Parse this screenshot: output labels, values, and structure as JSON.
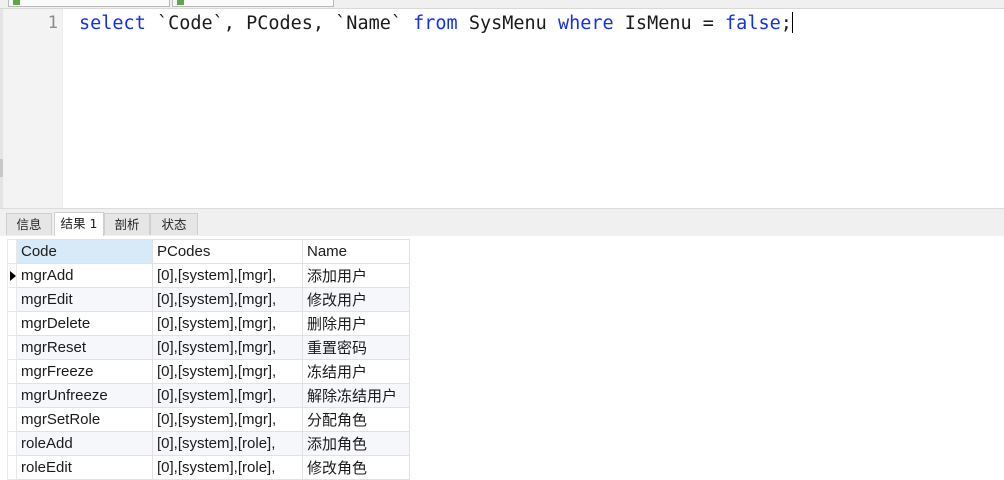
{
  "editor": {
    "line_number": "1",
    "tokens": {
      "select": "select",
      "code_col": " `Code`, PCodes, `Name` ",
      "from": "from",
      "table": " SysMenu ",
      "where": "where",
      "cond": " IsMenu = ",
      "false": "false",
      "semi": ";"
    }
  },
  "tabs": [
    "信息",
    "结果 1",
    "剖析",
    "状态"
  ],
  "active_tab": 1,
  "grid": {
    "columns": [
      "Code",
      "PCodes",
      "Name"
    ],
    "rows": [
      [
        "mgrAdd",
        "[0],[system],[mgr],",
        "添加用户"
      ],
      [
        "mgrEdit",
        "[0],[system],[mgr],",
        "修改用户"
      ],
      [
        "mgrDelete",
        "[0],[system],[mgr],",
        "删除用户"
      ],
      [
        "mgrReset",
        "[0],[system],[mgr],",
        "重置密码"
      ],
      [
        "mgrFreeze",
        "[0],[system],[mgr],",
        "冻结用户"
      ],
      [
        "mgrUnfreeze",
        "[0],[system],[mgr],",
        "解除冻结用户"
      ],
      [
        "mgrSetRole",
        "[0],[system],[mgr],",
        "分配角色"
      ],
      [
        "roleAdd",
        "[0],[system],[role],",
        "添加角色"
      ],
      [
        "roleEdit",
        "[0],[system],[role],",
        "修改角色"
      ]
    ]
  },
  "colors": {
    "keyword": "#1030f0",
    "selected_header": "#d8e9f8"
  }
}
